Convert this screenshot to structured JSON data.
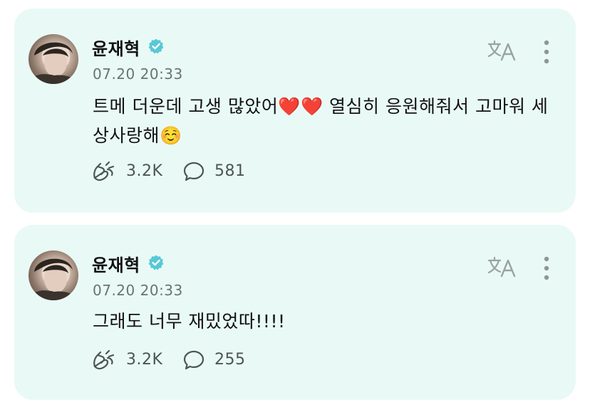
{
  "colors": {
    "card_bg": "#e9faf6",
    "verified": "#58c8d6",
    "muted": "#6a7370"
  },
  "icons": {
    "verified": "verified-badge-icon",
    "translate": "translate-icon",
    "more": "more-vertical-icon",
    "like": "hands-cheer-icon",
    "comment": "comment-bubble-icon"
  },
  "posts": [
    {
      "author": "윤재혁",
      "time": "07.20 20:33",
      "text": "트메 더운데 고생 많았어❤️❤️ 열심히 응원해줘서 고마워 세상사랑해☺️",
      "likes": "3.2K",
      "comments": "581"
    },
    {
      "author": "윤재혁",
      "time": "07.20 20:33",
      "text": "그래도 너무 재밌었따!!!!",
      "likes": "3.2K",
      "comments": "255"
    }
  ]
}
